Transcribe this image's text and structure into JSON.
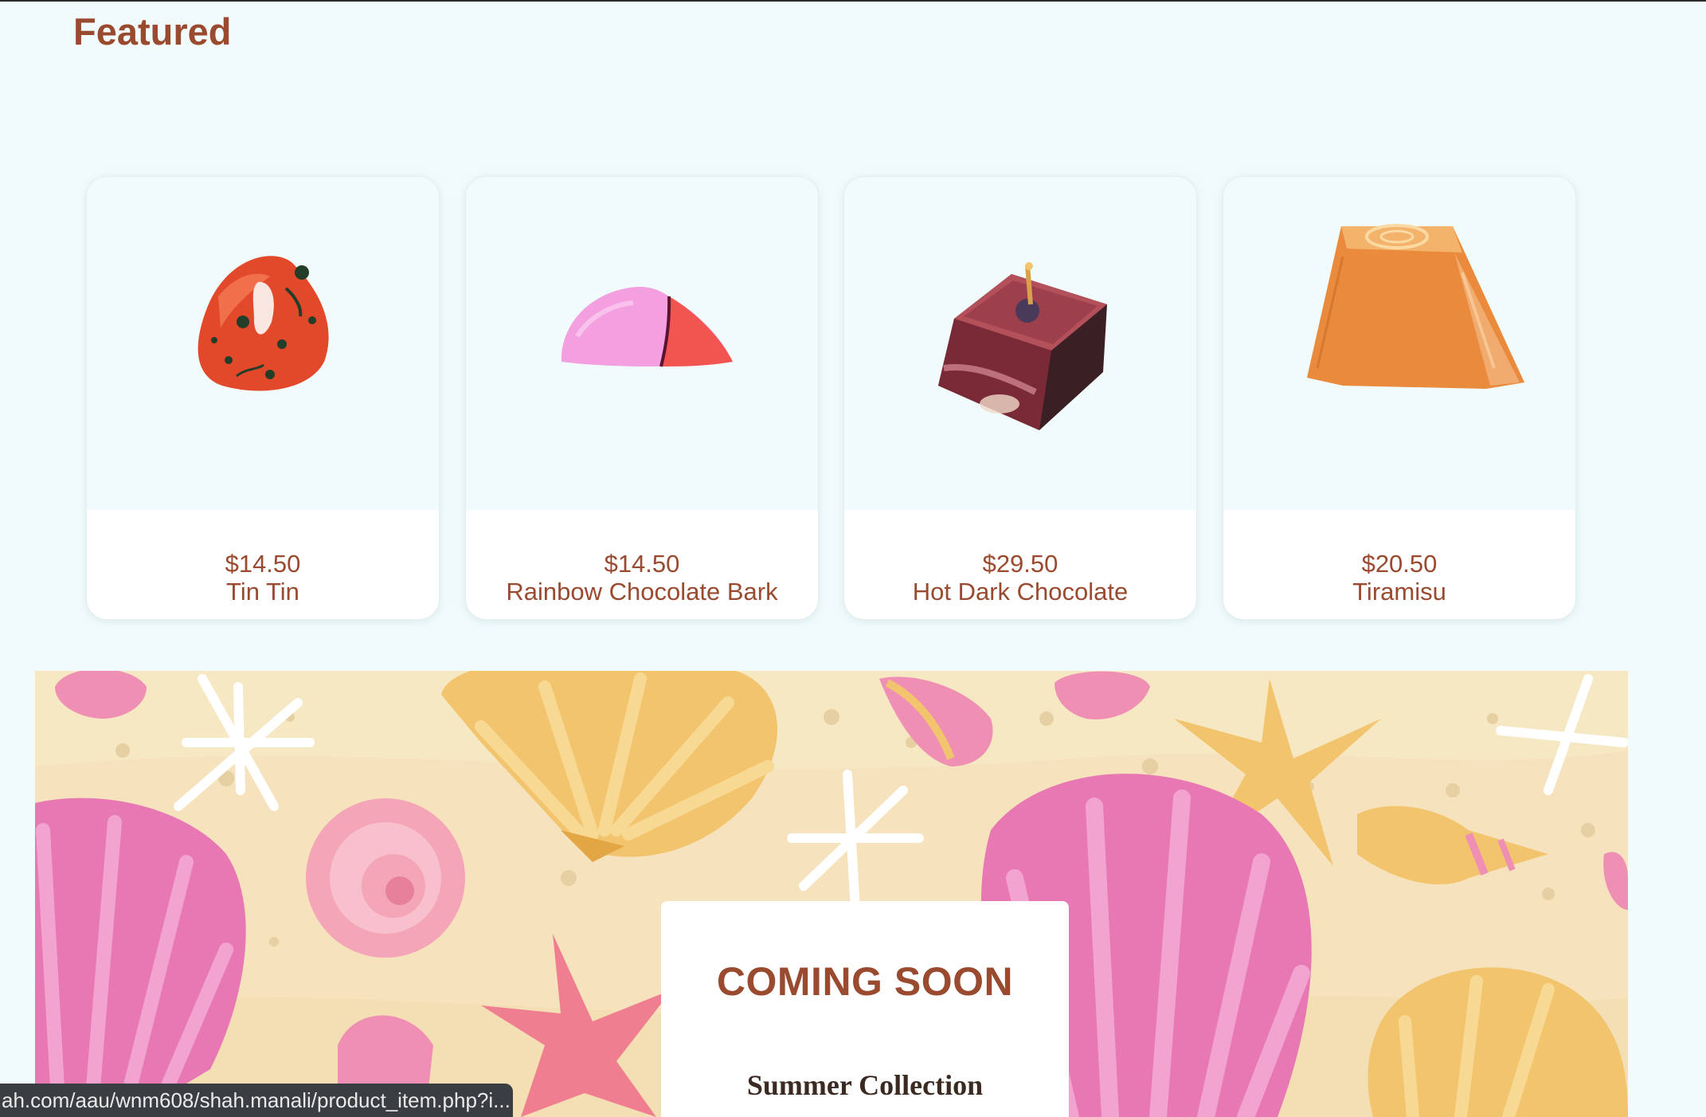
{
  "featured": {
    "title": "Featured",
    "products": [
      {
        "price": "$14.50",
        "name": "Tin Tin"
      },
      {
        "price": "$14.50",
        "name": "Rainbow Chocolate Bark"
      },
      {
        "price": "$29.50",
        "name": "Hot Dark Chocolate"
      },
      {
        "price": "$20.50",
        "name": "Tiramisu"
      }
    ]
  },
  "promo": {
    "heading": "COMING SOON",
    "subheading": "Summer Collection"
  },
  "status_bar": {
    "url": "ah.com/aau/wnm608/shah.manali/product_item.php?i..."
  },
  "colors": {
    "page_bg": "#f1fbfc",
    "accent_text": "#9a4a2f",
    "sand": "#f6e3bd",
    "shell_pink": "#e878b4",
    "shell_yellow": "#f3c46e"
  }
}
